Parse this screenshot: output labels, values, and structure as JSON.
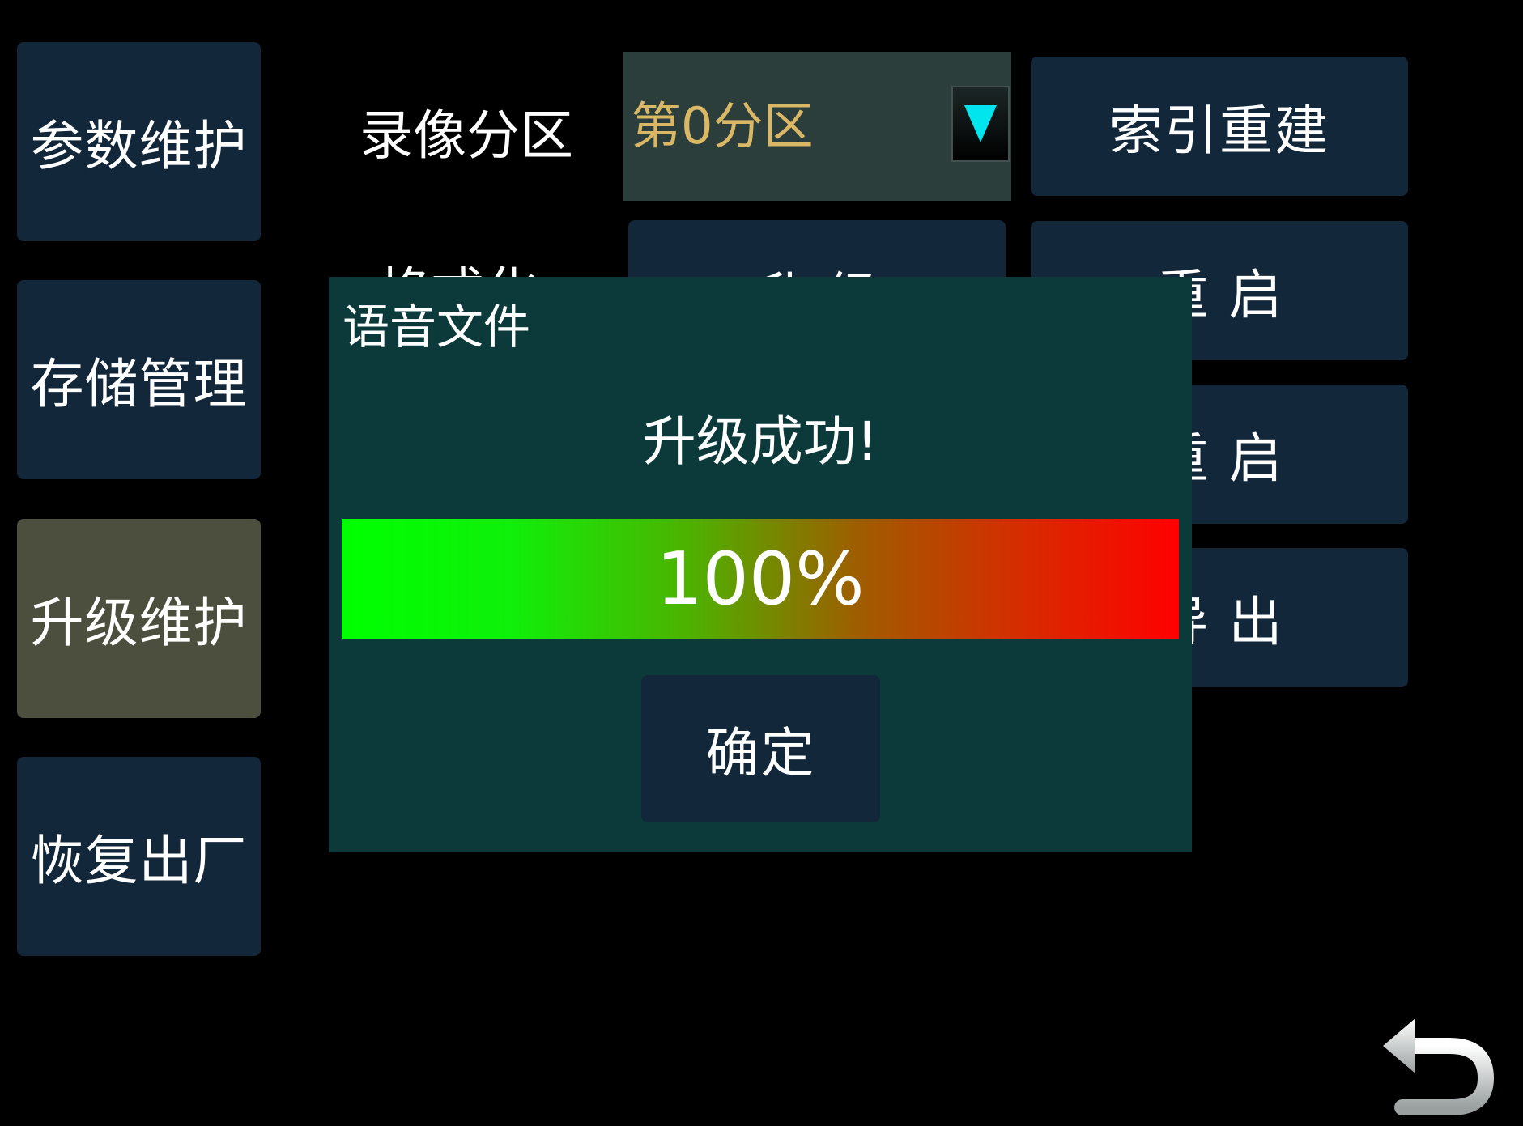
{
  "sidebar": {
    "items": [
      {
        "label": "参数维护",
        "active": false
      },
      {
        "label": "存储管理",
        "active": false
      },
      {
        "label": "升级维护",
        "active": true
      },
      {
        "label": "恢复出厂",
        "active": false
      }
    ]
  },
  "main": {
    "partition_label": "录像分区",
    "partition_select": {
      "value": "第0分区"
    },
    "buttons": {
      "rebuild_index": "索引重建",
      "restart_1": "重 启",
      "restart_2": "重 启",
      "export": "导 出",
      "upgrade": "升 级"
    },
    "partial_label": "格式化"
  },
  "dialog": {
    "title": "语音文件",
    "message": "升级成功!",
    "progress": {
      "value": 1.0,
      "text": "100%"
    },
    "ok_label": "确定"
  },
  "colors": {
    "button_bg": "#13273a",
    "active_bg": "#4c4f3e",
    "dialog_bg": "#0c3a3a",
    "dropdown_text": "#d9b765",
    "arrow": "#00e5ee"
  },
  "icons": {
    "dropdown": "triangle-down-icon",
    "back": "back-arrow-icon"
  }
}
